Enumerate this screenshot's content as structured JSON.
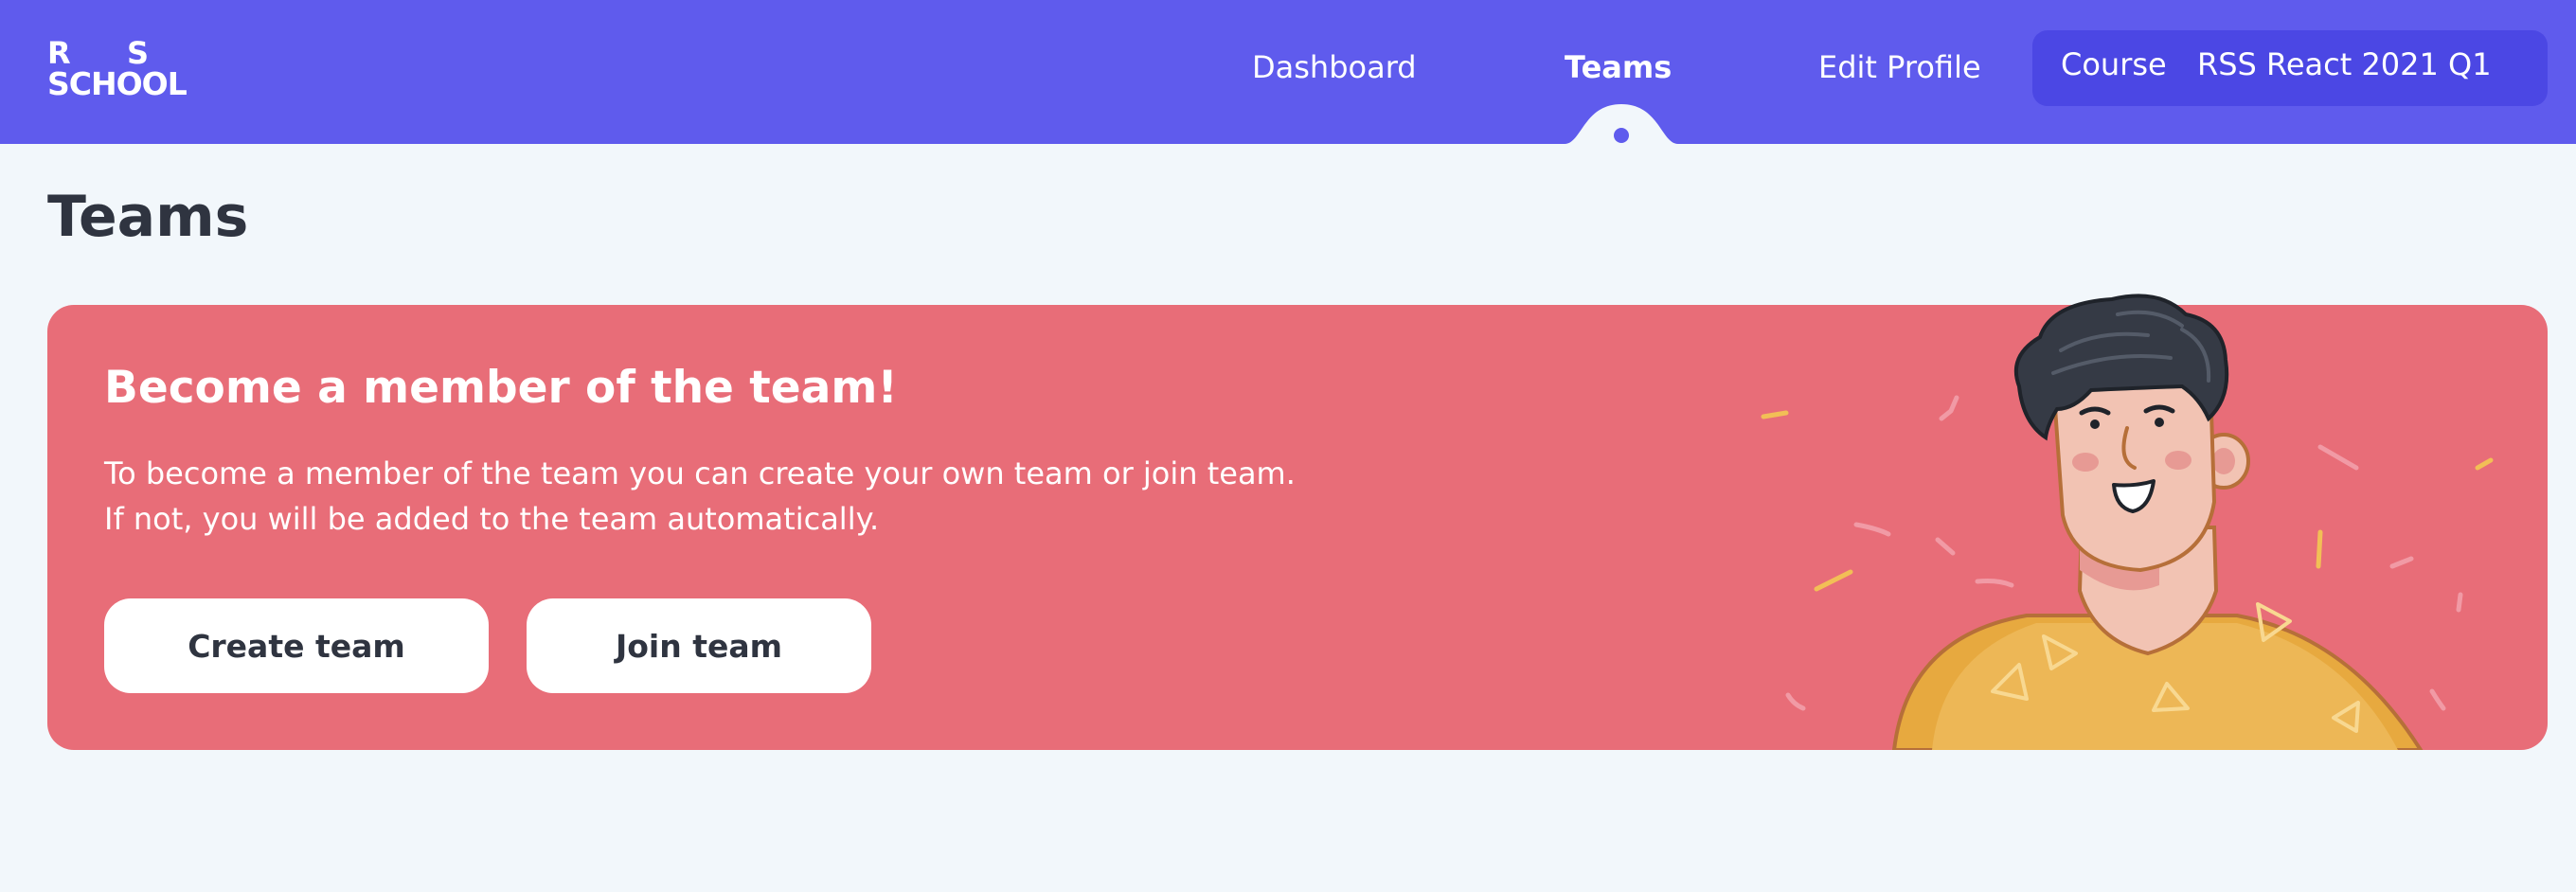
{
  "header": {
    "logo": {
      "line1_left": "R",
      "line1_right": "S",
      "line2": "SCHOOL"
    },
    "nav": [
      {
        "label": "Dashboard",
        "active": false
      },
      {
        "label": "Teams",
        "active": true
      },
      {
        "label": "Edit Profile",
        "active": false
      }
    ],
    "course": {
      "label": "Course",
      "value": "RSS React 2021 Q1"
    }
  },
  "page": {
    "title": "Teams"
  },
  "banner": {
    "title": "Become a member of the team!",
    "text_line1": "To become a member of the team you can create your own team or join team.",
    "text_line2": "If not, you will be added to the team automatically.",
    "create_label": "Create team",
    "join_label": "Join team"
  },
  "colors": {
    "header": "#5f5bed",
    "course_select": "#4b47e4",
    "banner": "#e86d78",
    "background": "#f2f7fb",
    "text_dark": "#2f3440"
  },
  "icons": {
    "active_tab_indicator": "tab-notch-icon",
    "illustration": "smiling-person-illustration"
  }
}
